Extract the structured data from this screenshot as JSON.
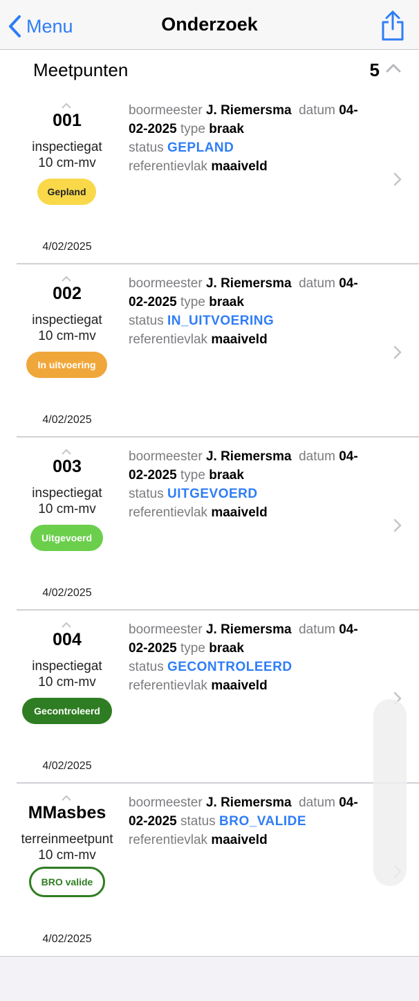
{
  "nav": {
    "back_label": "Menu",
    "title": "Onderzoek",
    "share_icon": "share-icon"
  },
  "section": {
    "title": "Meetpunten",
    "count": "5"
  },
  "labels": {
    "boormeester": "boormeester",
    "datum": "datum",
    "type": "type",
    "status": "status",
    "referentievlak": "referentievlak"
  },
  "rows": [
    {
      "code": "001",
      "kind": "inspectiegat",
      "depth": "10 cm-mv",
      "badge": "Gepland",
      "date": "4/02/2025",
      "boormeester": "J. Riemersma",
      "datum_a": "04-",
      "datum_b": "02-2025",
      "type": "braak",
      "status": "GEPLAND",
      "referentievlak": "maaiveld"
    },
    {
      "code": "002",
      "kind": "inspectiegat",
      "depth": "10 cm-mv",
      "badge": "In uitvoering",
      "date": "4/02/2025",
      "boormeester": "J. Riemersma",
      "datum_a": "04-",
      "datum_b": "02-2025",
      "type": "braak",
      "status": "IN_UITVOERING",
      "referentievlak": "maaiveld"
    },
    {
      "code": "003",
      "kind": "inspectiegat",
      "depth": "10 cm-mv",
      "badge": "Uitgevoerd",
      "date": "4/02/2025",
      "boormeester": "J. Riemersma",
      "datum_a": "04-",
      "datum_b": "02-2025",
      "type": "braak",
      "status": "UITGEVOERD",
      "referentievlak": "maaiveld"
    },
    {
      "code": "004",
      "kind": "inspectiegat",
      "depth": "10 cm-mv",
      "badge": "Gecontroleerd",
      "date": "4/02/2025",
      "boormeester": "J. Riemersma",
      "datum_a": "04-",
      "datum_b": "02-2025",
      "type": "braak",
      "status": "GECONTROLEERD",
      "referentievlak": "maaiveld"
    },
    {
      "code": "MMasbes",
      "kind": "terreinmeetpunt",
      "depth": "10 cm-mv",
      "badge": "BRO valide",
      "date": "4/02/2025",
      "boormeester": "J. Riemersma",
      "datum_a": "04-",
      "datum_b": "02-2025",
      "status": "BRO_VALIDE",
      "referentievlak": "maaiveld"
    }
  ],
  "colors": {
    "accent": "#2f7df6",
    "gepland": "#f9d94a",
    "in_uitvoering": "#f0a73a",
    "uitgevoerd": "#6bcf4c",
    "gecontroleerd": "#2f7d22",
    "bro_valide_border": "#2f7d22"
  }
}
